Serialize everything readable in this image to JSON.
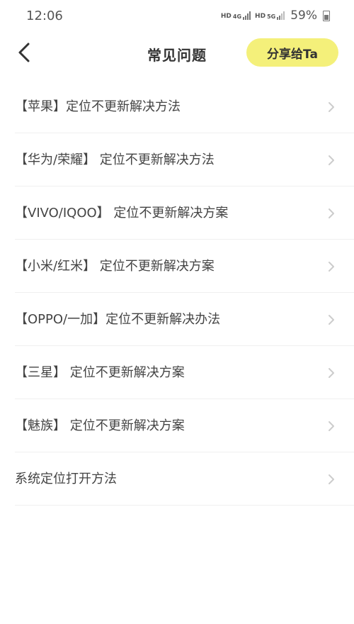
{
  "status": {
    "time": "12:06",
    "net1": "HD",
    "net1_type": "4G",
    "net2": "HD",
    "net2_type": "5G",
    "battery": "59%"
  },
  "header": {
    "title": "常见问题",
    "share_label": "分享给Ta"
  },
  "items": [
    {
      "label": "【苹果】定位不更新解决方法"
    },
    {
      "label": "【华为/荣耀】 定位不更新解决方法"
    },
    {
      "label": "【VIVO/IQOO】 定位不更新解决方案"
    },
    {
      "label": "【小米/红米】 定位不更新解决方案"
    },
    {
      "label": "【OPPO/一加】定位不更新解决办法"
    },
    {
      "label": "【三星】 定位不更新解决方案"
    },
    {
      "label": "【魅族】 定位不更新解决方案"
    },
    {
      "label": "系统定位打开方法"
    }
  ],
  "colors": {
    "accent": "#f4f07a",
    "text": "#444444",
    "chevron": "#cccccc"
  }
}
